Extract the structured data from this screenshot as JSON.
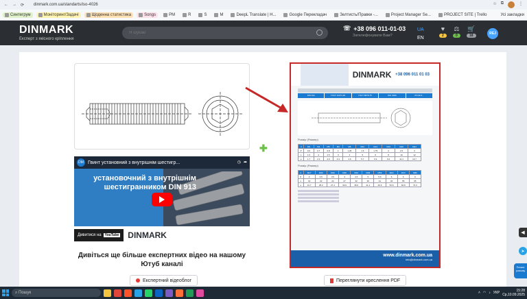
{
  "browser": {
    "url": "dinmark.com.ua/standarts/iso-4026"
  },
  "bookmarks": [
    {
      "label": "Cинтегрум",
      "tag": "green"
    },
    {
      "label": "Моніторинг/Задачі",
      "tag": "yellow"
    },
    {
      "label": "Щоденна статистика",
      "tag": "orange"
    },
    {
      "label": "Songs",
      "tag": "pink"
    },
    {
      "label": "PM",
      "tag": ""
    },
    {
      "label": "R",
      "tag": ""
    },
    {
      "label": "S",
      "tag": ""
    },
    {
      "label": "M",
      "tag": ""
    },
    {
      "label": "DeepL Translate | Н...",
      "tag": ""
    },
    {
      "label": "Google Перекладач",
      "tag": ""
    },
    {
      "label": "Зелтисть/Правки -...",
      "tag": ""
    },
    {
      "label": "Project Manager Se...",
      "tag": ""
    },
    {
      "label": "PROJECT SITE | Trello",
      "tag": ""
    }
  ],
  "bookmarks_all": "Усі закладки",
  "header": {
    "logo": "DINMARK",
    "tagline": "Експерт з якісного кріплення",
    "search_placeholder": "Я шукаю",
    "phone": "+38 096 011-01-03",
    "phone_sub": "Зателефонувати Вам?",
    "lang_ua": "UA",
    "lang_en": "EN",
    "favorites_count": "2",
    "compare_count": "0",
    "cart_count": "18",
    "avatar_text": "REJ"
  },
  "video": {
    "title": "Гвинт установний з внутрішнім шестигр...",
    "share_label": "Поділитися",
    "headline": "установочний з внутрішнім шестигранником DIN 913",
    "watch_on": "Дивитися на",
    "youtube": "YouTube",
    "brand": "DINMARK"
  },
  "channel_text": "Дивіться ще більше експертних відео на нашому Ютуб каналі",
  "buttons": {
    "expert_video": "Експертний відеоблог",
    "view_pdf": "Переглянути креслення PDF"
  },
  "pdf": {
    "logo": "DINMARK",
    "phone": "+38 096 011 01 03",
    "site": "www.dinmark.com.ua",
    "mail": "info@dinmark.com.ua",
    "tabs": [
      "DIN 913",
      "ГОСТ 11074-93",
      "ГОСТ 8878-75",
      "ISO 4026",
      "PN-M-8..."
    ],
    "label_1": "Розмір (Размер)",
    "label_2": "Розмір (Размер)",
    "table_1_header": [
      "d",
      "M3",
      "M4",
      "M5",
      "M6",
      "M8",
      "M10",
      "M12",
      "M16",
      "M20",
      "M24"
    ],
    "table_1_rows": [
      [
        "P",
        "0.5",
        "0.7",
        "0.8",
        "1",
        "1.25",
        "1.5",
        "1.75",
        "2",
        "2.5",
        "3"
      ],
      [
        "s",
        "1.5",
        "2",
        "2.5",
        "3",
        "4",
        "5",
        "6",
        "8",
        "10",
        "12"
      ],
      [
        "e",
        "1.7",
        "2.3",
        "2.9",
        "3.4",
        "4.6",
        "5.7",
        "6.9",
        "9.2",
        "11.4",
        "13.7"
      ]
    ],
    "table_2_header": [
      "d",
      "M27",
      "M30",
      "M33",
      "M36",
      "M42",
      "M48",
      "M56",
      "M64",
      "M72",
      "M80"
    ],
    "table_2_rows": [
      [
        "P",
        "3",
        "3.5",
        "3.5",
        "4",
        "4.5",
        "5",
        "5.5",
        "6",
        "6",
        "6"
      ],
      [
        "s",
        "19",
        "22",
        "24",
        "27",
        "32",
        "36",
        "41",
        "46",
        "55",
        "65"
      ],
      [
        "e",
        "21.7",
        "25.2",
        "27.4",
        "30.9",
        "36.6",
        "41.1",
        "46.9",
        "52.6",
        "62.8",
        "74.3"
      ]
    ]
  },
  "side": {
    "chat_label": "Почати розмову"
  },
  "taskbar": {
    "search_placeholder": "Пошук",
    "lang": "УКР",
    "time": "15:28",
    "date": "Ср,10.09.2025"
  },
  "colors": {
    "header_bg": "#2b2e32",
    "accent_blue": "#1a7ad0",
    "arrow_red": "#c62828",
    "plus_green": "#6cc04a"
  }
}
